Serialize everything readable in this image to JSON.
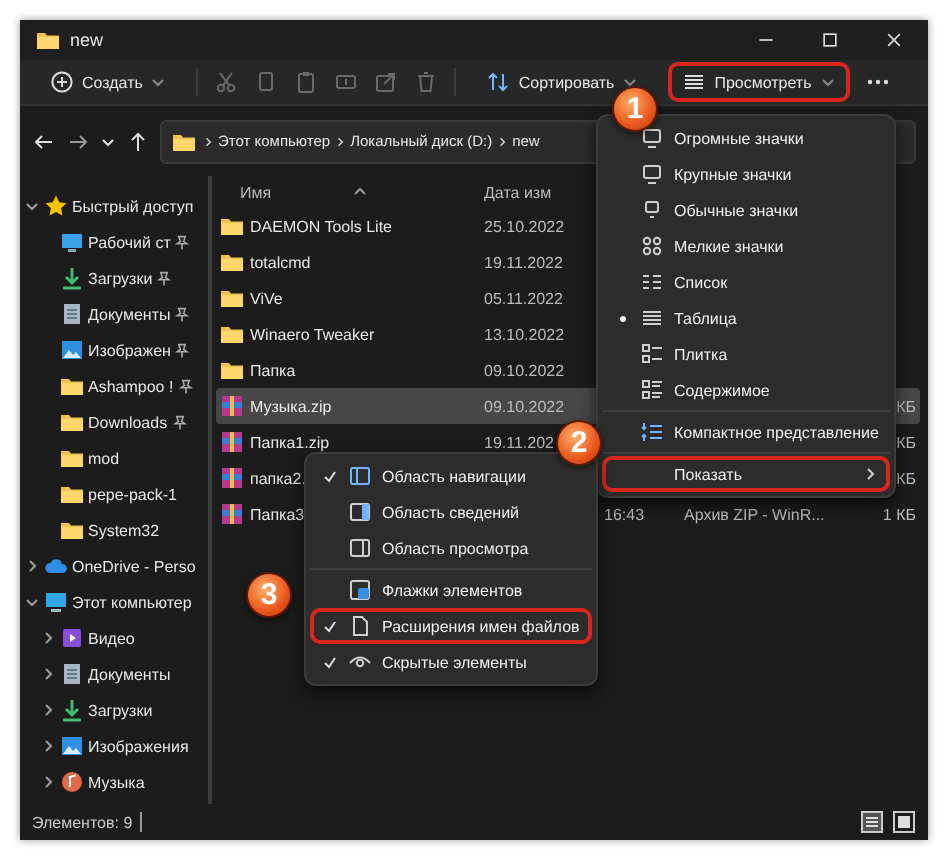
{
  "window": {
    "title": "new"
  },
  "toolbar": {
    "create": "Создать",
    "sort": "Сортировать",
    "view": {
      "label": "Просмотреть",
      "highlighted": true
    }
  },
  "address": {
    "crumbs": [
      "Этот компьютер",
      "Локальный диск (D:)",
      "new"
    ]
  },
  "columns": [
    "Имя",
    "Дата изм"
  ],
  "files": [
    {
      "name": "DAEMON Tools Lite",
      "kind": "folder",
      "date": "25.10.2022",
      "selected": false
    },
    {
      "name": "totalcmd",
      "kind": "folder",
      "date": "19.11.2022",
      "selected": false
    },
    {
      "name": "ViVe",
      "kind": "folder",
      "date": "05.11.2022",
      "selected": false
    },
    {
      "name": "Winaero Tweaker",
      "kind": "folder",
      "date": "13.10.2022",
      "selected": false
    },
    {
      "name": "Папка",
      "kind": "folder",
      "date": "09.10.2022",
      "selected": false
    },
    {
      "name": "Музыка.zip",
      "kind": "zip",
      "date": "09.10.2022",
      "size": "КБ",
      "selected": true
    },
    {
      "name": "Папка1.zip",
      "kind": "zip",
      "date": "19.11.202",
      "size": "КБ",
      "selected": false
    },
    {
      "name": "папка2.",
      "kind": "zip",
      "size": "КБ",
      "selected": false
    },
    {
      "name": "Папка3",
      "kind": "zip",
      "time": "16:43",
      "type": "Архив ZIP - WinR...",
      "size": "1 КБ",
      "selected": false
    }
  ],
  "sidebar": [
    {
      "label": "Быстрый доступ",
      "expanded": true,
      "children": [
        {
          "label": "Рабочий ст",
          "pinned": true
        },
        {
          "label": "Загрузки",
          "pinned": true
        },
        {
          "label": "Документы",
          "pinned": true
        },
        {
          "label": "Изображен",
          "pinned": true
        },
        {
          "label": "Ashampoo !",
          "pinned": true
        },
        {
          "label": "Downloads",
          "pinned": true
        },
        {
          "label": "mod",
          "pinned": false
        },
        {
          "label": "pepe-pack-1",
          "pinned": false
        },
        {
          "label": "System32",
          "pinned": false
        }
      ]
    },
    {
      "label": "OneDrive - Perso",
      "expanded": false
    },
    {
      "label": "Этот компьютер",
      "expanded": true,
      "children": [
        {
          "label": "Видео",
          "expanded": false
        },
        {
          "label": "Документы",
          "expanded": false
        },
        {
          "label": "Загрузки",
          "expanded": false
        },
        {
          "label": "Изображения",
          "expanded": false
        },
        {
          "label": "Музыка",
          "expanded": false
        }
      ]
    }
  ],
  "view_menu": {
    "groups": [
      [
        {
          "label": "Огромные значки",
          "selected": false
        },
        {
          "label": "Крупные значки",
          "selected": false
        },
        {
          "label": "Обычные значки",
          "selected": false
        },
        {
          "label": "Мелкие значки",
          "selected": false
        },
        {
          "label": "Список",
          "selected": false
        },
        {
          "label": "Таблица",
          "selected": true
        },
        {
          "label": "Плитка",
          "selected": false
        },
        {
          "label": "Содержимое",
          "selected": false
        }
      ],
      [
        {
          "label": "Компактное представление",
          "selected": false
        }
      ]
    ],
    "show": {
      "label": "Показать",
      "highlighted": true
    }
  },
  "show_menu": {
    "groups": [
      [
        {
          "label": "Область навигации",
          "checked": true,
          "highlighted": false
        },
        {
          "label": "Область сведений",
          "checked": false,
          "highlighted": false
        },
        {
          "label": "Область просмотра",
          "checked": false,
          "highlighted": false
        }
      ],
      [
        {
          "label": "Флажки элементов",
          "checked": false,
          "highlighted": false
        },
        {
          "label": "Расширения имен файлов",
          "checked": true,
          "highlighted": true
        },
        {
          "label": "Скрытые элементы",
          "checked": true,
          "highlighted": false
        }
      ]
    ]
  },
  "callouts": [
    "1",
    "2",
    "3"
  ],
  "status_bar": "Элементов: 9"
}
